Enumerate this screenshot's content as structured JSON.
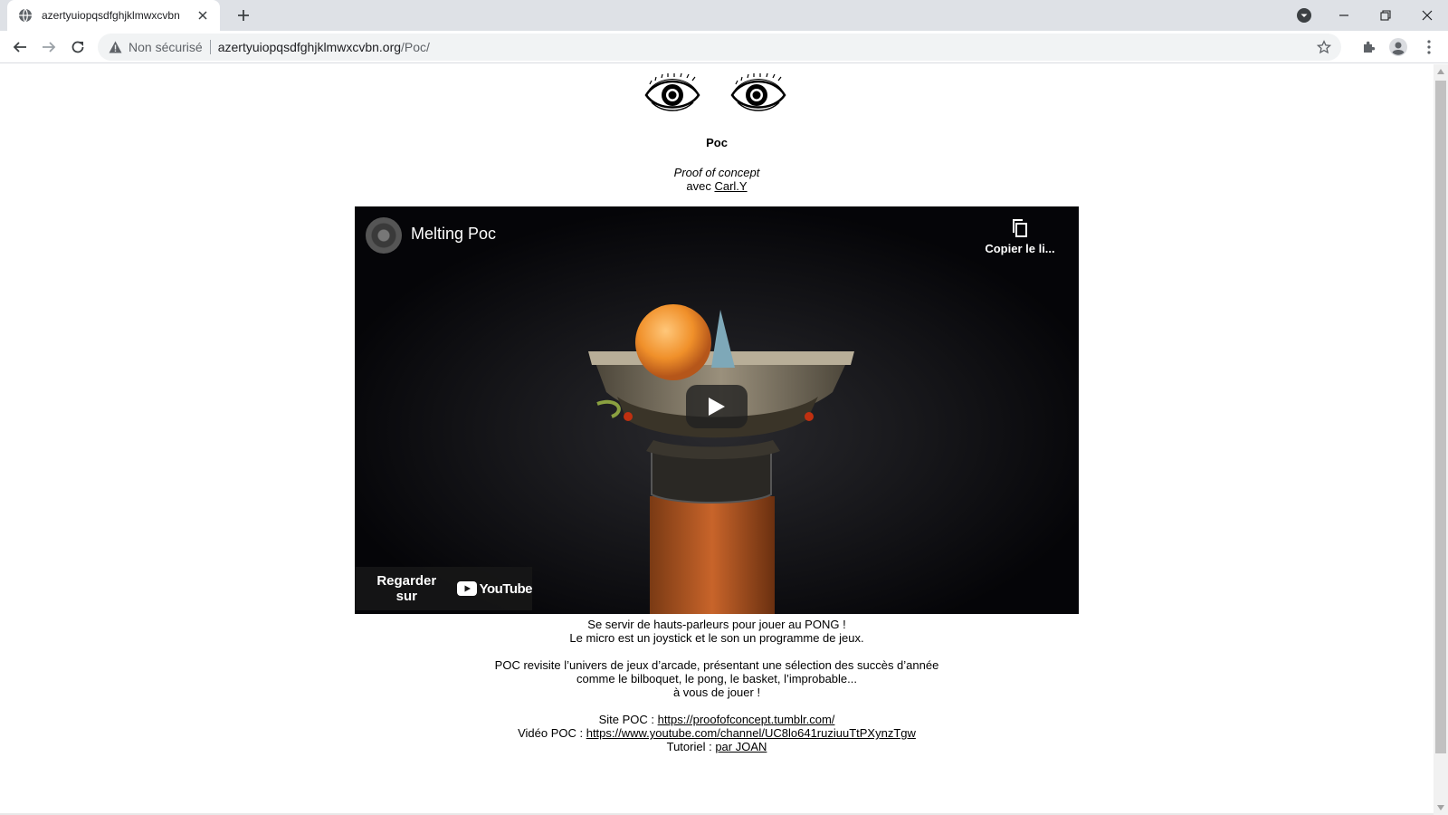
{
  "browser": {
    "tab": {
      "title": "azertyuiopqsdfghjklmwxcvbn"
    },
    "omnibox": {
      "security_label": "Non sécurisé",
      "url_host": "azertyuiopqsdfghjklmwxcvbn.org",
      "url_path": "/Poc/"
    },
    "icons": {
      "favicon": "globe-icon",
      "tab_close": "close-icon",
      "new_tab": "plus-icon",
      "profile_menu": "chevron-down-circle-icon",
      "minimize": "minimize-icon",
      "restore": "restore-icon",
      "close_window": "close-icon",
      "back": "back-arrow-icon",
      "forward": "forward-arrow-icon",
      "reload": "reload-icon",
      "warning": "warning-triangle-icon",
      "bookmark": "star-icon",
      "extensions": "puzzle-icon",
      "profile": "avatar-icon",
      "menu": "kebab-menu-icon"
    }
  },
  "page": {
    "logo": "eyes-logo",
    "title": "Poc",
    "subtitle": "Proof of concept",
    "credit_prefix": "avec ",
    "credit_link": "Carl.Y",
    "video": {
      "title": "Melting Poc",
      "copy_link_label": "Copier le li...",
      "watch_on_label": "Regarder sur",
      "youtube_label": "YouTube",
      "icons": {
        "play": "play-icon",
        "copy": "copy-icon",
        "channel": "channel-avatar"
      }
    },
    "description": {
      "line1": "Se servir de hauts-parleurs pour jouer au PONG !",
      "line2": "Le micro est un joystick et le son un programme de jeux.",
      "line3": "POC revisite l’univers de jeux d’arcade, présentant une sélection des succès d’année",
      "line4": "comme le bilboquet, le pong, le basket, l’improbable...",
      "line5": "à vous de jouer !"
    },
    "links": {
      "site_label": "Site POC : ",
      "site_url": "https://proofofconcept.tumblr.com/",
      "video_label": "Vidéo POC : ",
      "video_url": "https://www.youtube.com/channel/UC8lo641ruziuuTtPXynzTgw",
      "tutorial_label": "Tutoriel : ",
      "tutorial_link": "par JOAN"
    }
  },
  "colors": {
    "tabstrip_bg": "#dee1e6",
    "omnibox_bg": "#f1f3f4",
    "video_bg": "#050508",
    "youtube_red": "#ff0000"
  }
}
